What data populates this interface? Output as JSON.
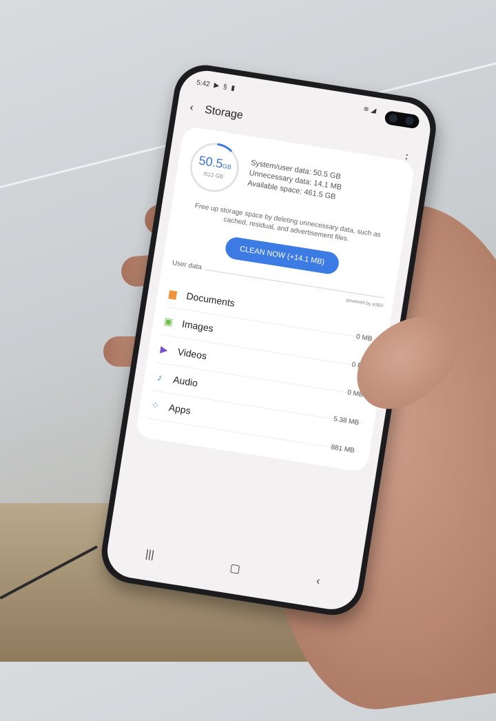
{
  "status_bar": {
    "time": "5:42",
    "icons": [
      "play-icon",
      "sync-icon",
      "download-icon"
    ],
    "right_icons": [
      "wifi-icon",
      "signal-icon"
    ]
  },
  "header": {
    "title": "Storage",
    "back_icon": "back-arrow-icon",
    "more_icon": "more-vert-icon"
  },
  "storage": {
    "used_value": "50.5",
    "used_unit": "GB",
    "total": "/512 GB",
    "used_fraction": 0.099,
    "system_user_data": "System/user data: 50.5 GB",
    "unnecessary_data": "Unnecessary data: 14.1 MB",
    "available_space": "Available space: 461.5 GB",
    "description": "Free up storage space by deleting unnecessary data, such as cached, residual, and advertisement files.",
    "clean_button": "CLEAN NOW (+14.1 MB)",
    "accent": "#3c7be3"
  },
  "user_data": {
    "label": "User data",
    "powered_by": "powered by ⌀360",
    "items": [
      {
        "name": "Documents",
        "size": "0 MB",
        "icon": "document-icon",
        "color": "#f0923a"
      },
      {
        "name": "Images",
        "size": "0 MB",
        "icon": "image-icon",
        "color": "#6cbf4b"
      },
      {
        "name": "Videos",
        "size": "0 MB",
        "icon": "video-icon",
        "color": "#7a4fd0"
      },
      {
        "name": "Audio",
        "size": "5.38 MB",
        "icon": "music-note-icon",
        "color": "#3f86e0"
      },
      {
        "name": "Apps",
        "size": "881 MB",
        "icon": "apps-icon",
        "color": "#3f86e0"
      }
    ]
  },
  "nav": {
    "recents_icon": "recents-icon",
    "home_icon": "home-icon",
    "back_icon": "back-icon"
  }
}
